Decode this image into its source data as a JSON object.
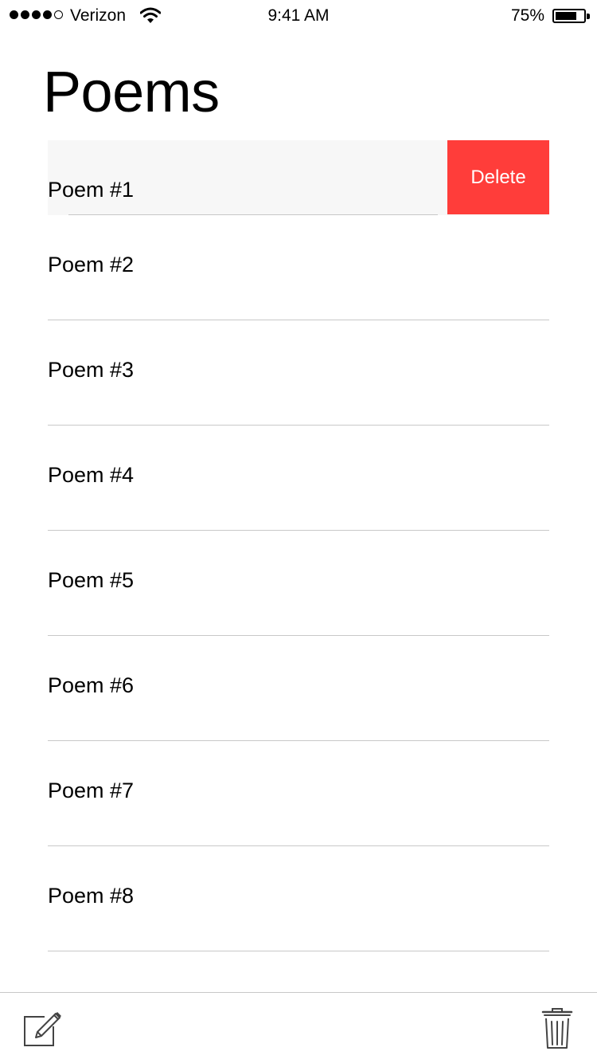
{
  "status_bar": {
    "carrier": "Verizon",
    "time": "9:41 AM",
    "battery_percent": "75%",
    "battery_level": 0.75,
    "signal_bars_filled": 4,
    "signal_bars_total": 5
  },
  "header": {
    "title": "Poems"
  },
  "list": {
    "swiped_row": {
      "label": "Poem #1",
      "action_label": "Delete",
      "action_color": "#ff3d3a"
    },
    "items": [
      {
        "label": "Poem #2"
      },
      {
        "label": "Poem #3"
      },
      {
        "label": "Poem #4"
      },
      {
        "label": "Poem #5"
      },
      {
        "label": "Poem #6"
      },
      {
        "label": "Poem #7"
      },
      {
        "label": "Poem #8"
      }
    ]
  },
  "toolbar": {
    "left_icon": "compose-icon",
    "right_icon": "trash-icon"
  }
}
